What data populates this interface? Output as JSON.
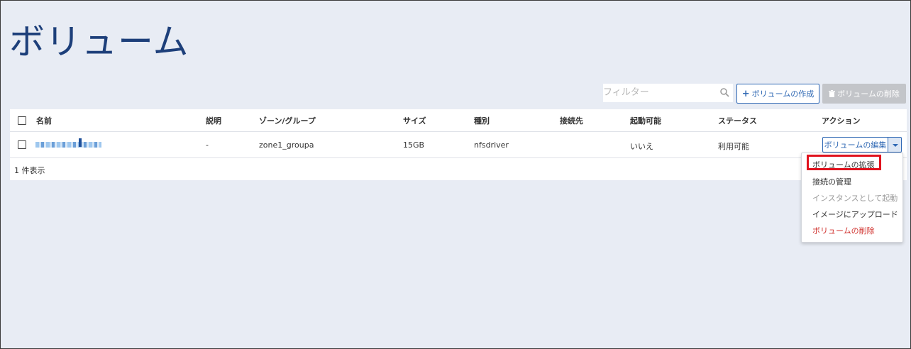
{
  "page": {
    "title": "ボリューム"
  },
  "toolbar": {
    "filter_placeholder": "フィルター",
    "create_label": "ボリュームの作成",
    "delete_label": "ボリュームの削除"
  },
  "table": {
    "headers": {
      "name": "名前",
      "description": "説明",
      "zone": "ゾーン/グループ",
      "size": "サイズ",
      "type": "種別",
      "attached_to": "接続先",
      "bootable": "起動可能",
      "status": "ステータス",
      "actions": "アクション"
    },
    "rows": [
      {
        "description": "-",
        "zone": "zone1_groupa",
        "size": "15GB",
        "type": "nfsdriver",
        "attached_to": "",
        "bootable": "いいえ",
        "status": "利用可能",
        "action_label": "ボリュームの編集"
      }
    ],
    "count_text": "1 件表示"
  },
  "actions_menu": {
    "items": [
      {
        "label": "ボリュームの拡張",
        "state": "normal",
        "highlighted": true
      },
      {
        "label": "接続の管理",
        "state": "normal"
      },
      {
        "label": "インスタンスとして起動",
        "state": "disabled"
      },
      {
        "label": "イメージにアップロード",
        "state": "normal"
      },
      {
        "label": "ボリュームの削除",
        "state": "danger"
      }
    ]
  },
  "colors": {
    "title": "#1d3f7a",
    "primary": "#2f68b4",
    "danger": "#d0312d",
    "highlight": "#e0121d",
    "background": "#e8ecf4"
  },
  "icons": {
    "filter": "search-icon",
    "create": "plus-icon",
    "delete": "trash-icon",
    "dropdown": "caret-down-icon"
  }
}
